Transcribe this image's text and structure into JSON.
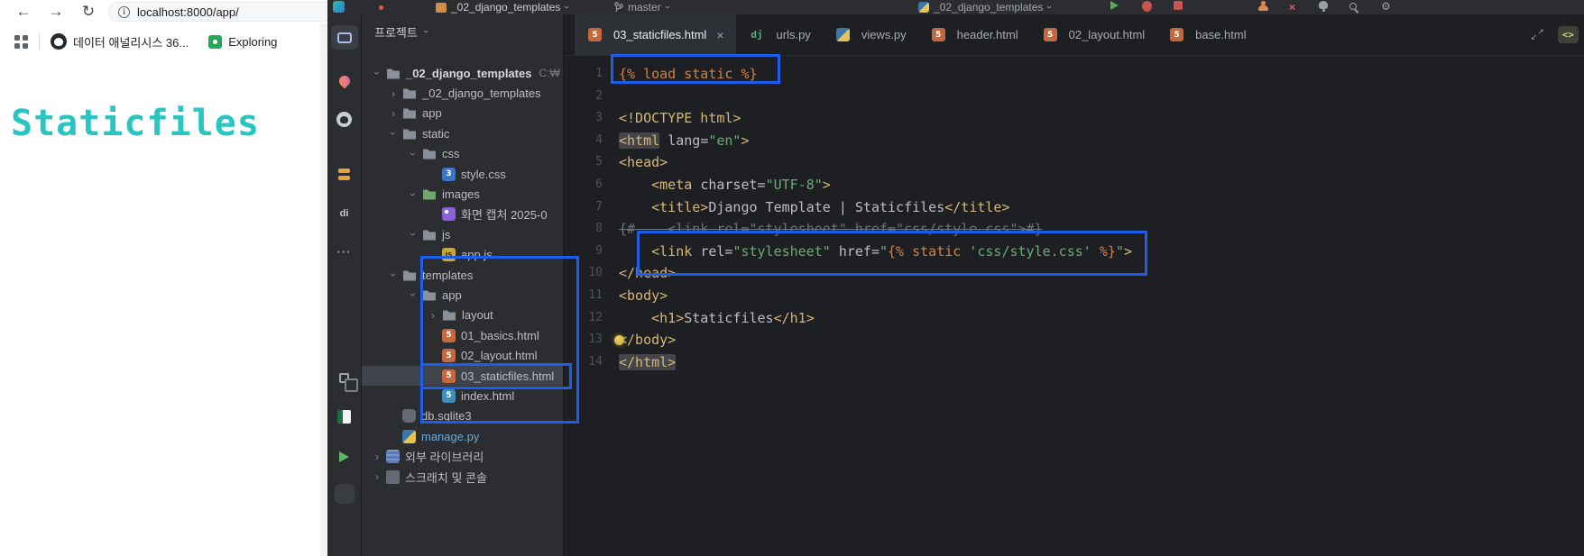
{
  "annotations": {
    "color": "#1D5DEB"
  },
  "browser": {
    "nav": {
      "back": "←",
      "forward": "→",
      "reload": "↻"
    },
    "address": "localhost:8000/app/",
    "bookmarks": [
      {
        "label": "데이터 애널리시스 36..."
      },
      {
        "label": "Exploring"
      }
    ],
    "page": {
      "heading": "Staticfiles",
      "heading_color": "#29C5C0"
    }
  },
  "ide": {
    "titlebar": {
      "project_name": "_02_django_templates",
      "branch": "master",
      "run_config": "_02_django_templates"
    },
    "tool_stripe": {
      "icons": [
        {
          "name": "project",
          "active": true
        },
        {
          "name": "packages"
        },
        {
          "name": "github"
        },
        {
          "name": "commit"
        },
        {
          "name": "database",
          "label": "di"
        },
        {
          "name": "more",
          "label": "···"
        },
        {
          "name": "services"
        },
        {
          "name": "sheets"
        },
        {
          "name": "run"
        },
        {
          "name": "terminal"
        }
      ]
    },
    "project_panel": {
      "header": "프로젝트",
      "tree": [
        {
          "level": 0,
          "chevron": "open",
          "icon": "folder",
          "label": "_02_django_templates",
          "hint": "C:₩",
          "bold": true
        },
        {
          "level": 1,
          "chevron": "closed",
          "icon": "folder",
          "label": "_02_django_templates"
        },
        {
          "level": 1,
          "chevron": "closed",
          "icon": "folder",
          "label": "app"
        },
        {
          "level": 1,
          "chevron": "open",
          "icon": "folder",
          "label": "static"
        },
        {
          "level": 2,
          "chevron": "open",
          "icon": "folder",
          "label": "css"
        },
        {
          "level": 3,
          "icon": "css",
          "label": "style.css"
        },
        {
          "level": 2,
          "chevron": "open",
          "icon": "folder-green",
          "label": "images"
        },
        {
          "level": 3,
          "icon": "img",
          "label": "화면 캡처 2025-0"
        },
        {
          "level": 2,
          "chevron": "open",
          "icon": "folder",
          "label": "js"
        },
        {
          "level": 3,
          "icon": "js",
          "label": "app.js"
        },
        {
          "level": 1,
          "chevron": "open",
          "icon": "folder",
          "label": "templates"
        },
        {
          "level": 2,
          "chevron": "open",
          "icon": "folder",
          "label": "app"
        },
        {
          "level": 3,
          "chevron": "closed",
          "icon": "folder",
          "label": "layout"
        },
        {
          "level": 3,
          "icon": "html",
          "label": "01_basics.html"
        },
        {
          "level": 3,
          "icon": "html",
          "label": "02_layout.html"
        },
        {
          "level": 3,
          "icon": "html",
          "label": "03_staticfiles.html",
          "selected": true
        },
        {
          "level": 3,
          "icon": "html-blue",
          "label": "index.html"
        },
        {
          "level": 1,
          "icon": "db",
          "label": "db.sqlite3"
        },
        {
          "level": 1,
          "icon": "py",
          "label": "manage.py",
          "cls": "blue"
        },
        {
          "level": 0,
          "chevron": "closed",
          "icon": "lib",
          "label": "외부 라이브러리"
        },
        {
          "level": 0,
          "chevron": "closed",
          "icon": "scratch",
          "label": "스크래치 및 콘솔"
        }
      ]
    },
    "editor": {
      "tabs": [
        {
          "icon": "html",
          "label": "03_staticfiles.html",
          "active": true,
          "close": "×"
        },
        {
          "icon": "dj",
          "label": "urls.py"
        },
        {
          "icon": "py",
          "label": "views.py"
        },
        {
          "icon": "html",
          "label": "header.html"
        },
        {
          "icon": "html",
          "label": "02_layout.html"
        },
        {
          "icon": "html",
          "label": "base.html"
        }
      ],
      "code_lines": [
        {
          "n": 1,
          "t": [
            [
              "dj",
              "{% load static %}"
            ]
          ]
        },
        {
          "n": 2,
          "t": []
        },
        {
          "n": 3,
          "t": [
            [
              "tag",
              "<!DOCTYPE html>"
            ]
          ]
        },
        {
          "n": 4,
          "t": [
            [
              "tag hl",
              "<html"
            ],
            [
              "plain",
              " "
            ],
            [
              "attr",
              "lang"
            ],
            [
              "plain",
              "="
            ],
            [
              "str",
              "\"en\""
            ],
            [
              "tag",
              ">"
            ]
          ]
        },
        {
          "n": 5,
          "t": [
            [
              "tag",
              "<head>"
            ]
          ]
        },
        {
          "n": 6,
          "t": [
            [
              "plain",
              "    "
            ],
            [
              "tag",
              "<meta"
            ],
            [
              "plain",
              " "
            ],
            [
              "attr",
              "charset"
            ],
            [
              "plain",
              "="
            ],
            [
              "str",
              "\"UTF-8\""
            ],
            [
              "tag",
              ">"
            ]
          ]
        },
        {
          "n": 7,
          "t": [
            [
              "plain",
              "    "
            ],
            [
              "tag",
              "<title>"
            ],
            [
              "plain",
              "Django Template | Staticfiles"
            ],
            [
              "tag",
              "</title>"
            ]
          ]
        },
        {
          "n": 8,
          "t": [
            [
              "comment",
              "{#    <link rel=\"stylesheet\" href=\"css/style.css\">#}"
            ]
          ]
        },
        {
          "n": 9,
          "t": [
            [
              "plain",
              "    "
            ],
            [
              "tag",
              "<link"
            ],
            [
              "plain",
              " "
            ],
            [
              "attr",
              "rel"
            ],
            [
              "plain",
              "="
            ],
            [
              "str",
              "\"stylesheet\""
            ],
            [
              "plain",
              " "
            ],
            [
              "attr",
              "href"
            ],
            [
              "plain",
              "="
            ],
            [
              "str",
              "\""
            ],
            [
              "dj",
              "{% static "
            ],
            [
              "str",
              "'css/style.css'"
            ],
            [
              "dj",
              " %}"
            ],
            [
              "str",
              "\""
            ],
            [
              "tag",
              ">"
            ]
          ]
        },
        {
          "n": 10,
          "t": [
            [
              "tag",
              "</head>"
            ]
          ]
        },
        {
          "n": 11,
          "t": [
            [
              "tag",
              "<body>"
            ]
          ]
        },
        {
          "n": 12,
          "t": [
            [
              "plain",
              "    "
            ],
            [
              "tag",
              "<h1>"
            ],
            [
              "plain",
              "Staticfiles"
            ],
            [
              "tag",
              "</h1>"
            ]
          ]
        },
        {
          "n": 13,
          "t": [
            [
              "tag",
              "</body>"
            ]
          ],
          "bulb": true
        },
        {
          "n": 14,
          "t": [
            [
              "tag hl",
              "</html>"
            ]
          ]
        }
      ]
    }
  }
}
